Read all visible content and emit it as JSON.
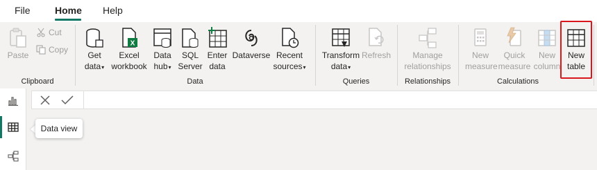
{
  "tabs": [
    {
      "label": "File"
    },
    {
      "label": "Home",
      "active": true
    },
    {
      "label": "Help"
    }
  ],
  "accent_color": "#117865",
  "highlight_color": "#d9161c",
  "clipboard": {
    "paste_label": "Paste",
    "cut_label": "Cut",
    "copy_label": "Copy",
    "group_label": "Clipboard"
  },
  "data_group": {
    "get_data": [
      "Get",
      "data"
    ],
    "excel": [
      "Excel",
      "workbook"
    ],
    "data_hub": [
      "Data",
      "hub"
    ],
    "sql_server": [
      "SQL",
      "Server"
    ],
    "enter_data": [
      "Enter",
      "data"
    ],
    "dataverse": [
      "Dataverse"
    ],
    "recent_sources": [
      "Recent",
      "sources"
    ],
    "group_label": "Data"
  },
  "queries": {
    "transform": [
      "Transform",
      "data"
    ],
    "refresh": [
      "Refresh"
    ],
    "group_label": "Queries"
  },
  "relationships": {
    "manage": [
      "Manage",
      "relationships"
    ],
    "group_label": "Relationships"
  },
  "calculations": {
    "new_measure": [
      "New",
      "measure"
    ],
    "quick_measure": [
      "Quick",
      "measure"
    ],
    "new_column": [
      "New",
      "column"
    ],
    "new_table": [
      "New",
      "table"
    ],
    "group_label": "Calculations"
  },
  "side_nav": {
    "items": [
      "report-view",
      "data-view",
      "model-view"
    ],
    "active": "data-view"
  },
  "tooltip": {
    "text": "Data view"
  },
  "formula_bar": {
    "value": "",
    "placeholder": ""
  },
  "icons": {
    "cancel": "close-icon",
    "commit": "check-icon"
  }
}
